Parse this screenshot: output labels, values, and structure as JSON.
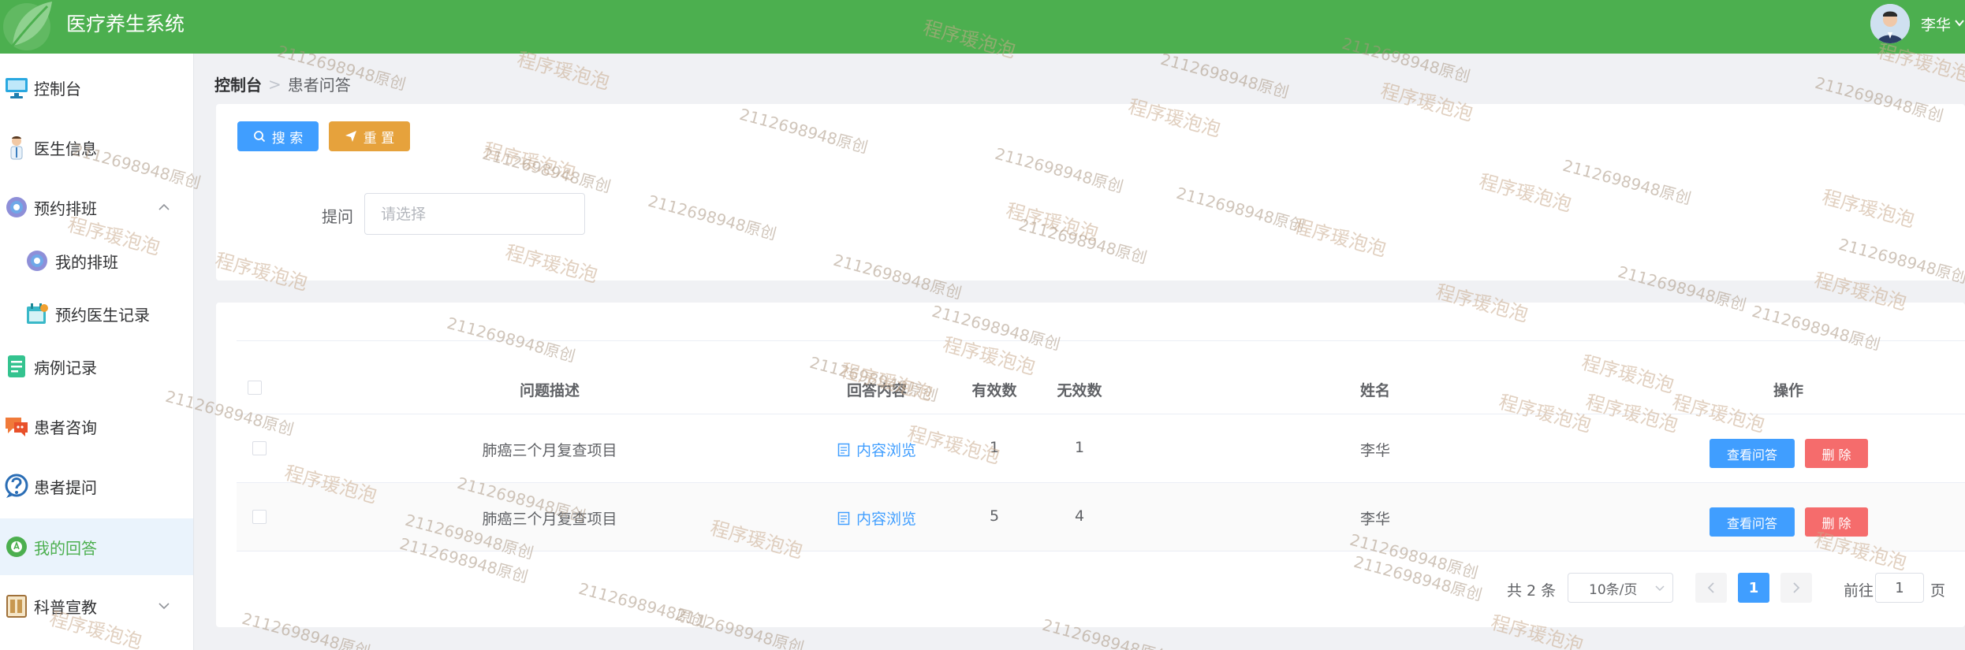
{
  "header": {
    "app_title": "医疗养生系统",
    "user_name": "李华"
  },
  "sidebar": {
    "items": [
      {
        "label": "控制台",
        "icon": "monitor-icon"
      },
      {
        "label": "医生信息",
        "icon": "doctor-icon"
      },
      {
        "label": "预约排班",
        "icon": "gear-icon",
        "expanded": true
      },
      {
        "label": "我的排班",
        "icon": "gear-icon"
      },
      {
        "label": "预约医生记录",
        "icon": "calendar-icon"
      },
      {
        "label": "病例记录",
        "icon": "document-icon"
      },
      {
        "label": "患者咨询",
        "icon": "chat-icon"
      },
      {
        "label": "患者提问",
        "icon": "question-icon"
      },
      {
        "label": "我的回答",
        "icon": "answer-icon",
        "active": true
      },
      {
        "label": "科普宣教",
        "icon": "book-icon"
      }
    ]
  },
  "breadcrumb": {
    "first": "控制台",
    "second": "患者问答"
  },
  "search": {
    "search_label": "搜 索",
    "reset_label": "重 置",
    "field_label": "提问",
    "placeholder": "请选择"
  },
  "table": {
    "headers": [
      "问题描述",
      "回答内容",
      "有效数",
      "无效数",
      "姓名",
      "操作"
    ],
    "rows": [
      {
        "question": "肺癌三个月复查项目",
        "content": "内容浏览",
        "valid": "1",
        "invalid": "1",
        "name": "李华",
        "view_label": "查看问答",
        "delete_label": "删 除"
      },
      {
        "question": "肺癌三个月复查项目",
        "content": "内容浏览",
        "valid": "5",
        "invalid": "4",
        "name": "李华",
        "view_label": "查看问答",
        "delete_label": "删 除"
      }
    ]
  },
  "pagination": {
    "total_text": "共 2 条",
    "page_size": "10条/页",
    "current_page": "1",
    "goto_label": "前往",
    "goto_value": "1",
    "goto_unit": "页"
  },
  "watermark": {
    "brand": "程序瑗泡泡",
    "code": "2112698948原创"
  },
  "colors": {
    "header": "#4caf4f",
    "primary": "#409eff",
    "warning": "#e6a23c",
    "danger": "#f56c6c",
    "active_menu_bg": "#eaf3fc"
  }
}
